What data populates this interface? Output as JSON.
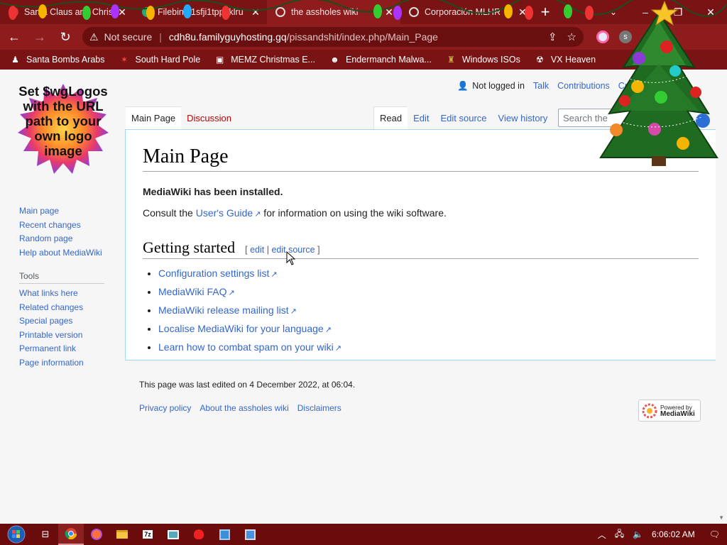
{
  "browser": {
    "tabs": [
      {
        "title": "Santa Claus and Christ",
        "fav_color": "#d33"
      },
      {
        "title": "Filebin | 1sfji1tpp9klru",
        "fav_color": "#2a7"
      },
      {
        "title": "the assholes wiki",
        "fav_color": "#888"
      },
      {
        "title": "Corporación MLHR",
        "fav_color": "#888"
      }
    ],
    "active_tab": 2,
    "tab_close_glyph": "✕",
    "new_tab_glyph": "+",
    "window_controls": [
      "–",
      "❐",
      "✕"
    ],
    "address": {
      "security": "Not secure",
      "host": "cdh8u.familyguyhosting.gq",
      "path": "/pissandshit/index.php/Main_Page"
    },
    "bookmarks": [
      {
        "label": "Santa Bombs Arabs",
        "icon": "♟"
      },
      {
        "label": "South Hard Pole",
        "icon": "✶"
      },
      {
        "label": "MEMZ Christmas E...",
        "icon": "▣"
      },
      {
        "label": "Endermanch Malwa...",
        "icon": "☻"
      },
      {
        "label": "Windows ISOs",
        "icon": "♜"
      },
      {
        "label": "VX Heaven",
        "icon": "☢"
      }
    ]
  },
  "wiki": {
    "logo_text": "Set $wgLogos with the URL path to your own logo image",
    "personal": {
      "not_logged_in": "Not logged in",
      "talk": "Talk",
      "contributions": "Contributions",
      "create": "Cr"
    },
    "tabs_left": [
      "Main Page",
      "Discussion"
    ],
    "tabs_right": [
      "Read",
      "Edit",
      "Edit source",
      "View history"
    ],
    "search_placeholder": "Search the",
    "title": "Main Page",
    "installed": "MediaWiki has been installed.",
    "consult_pre": "Consult the ",
    "consult_link": "User's Guide",
    "consult_post": " for information on using the wiki software.",
    "section_title": "Getting started",
    "section_edit": "edit",
    "section_edit_source": "edit source",
    "list": [
      "Configuration settings list",
      "MediaWiki FAQ",
      "MediaWiki release mailing list",
      "Localise MediaWiki for your language",
      "Learn how to combat spam on your wiki"
    ],
    "nav": [
      "Main page",
      "Recent changes",
      "Random page",
      "Help about MediaWiki"
    ],
    "tools_heading": "Tools",
    "tools": [
      "What links here",
      "Related changes",
      "Special pages",
      "Printable version",
      "Permanent link",
      "Page information"
    ],
    "last_edited": "This page was last edited on 4 December 2022, at 06:04.",
    "footer_links": [
      "Privacy policy",
      "About the assholes wiki",
      "Disclaimers"
    ],
    "powered_by": [
      "Powered by",
      "MediaWiki"
    ]
  },
  "taskbar": {
    "clock": "6:06:02 AM"
  }
}
